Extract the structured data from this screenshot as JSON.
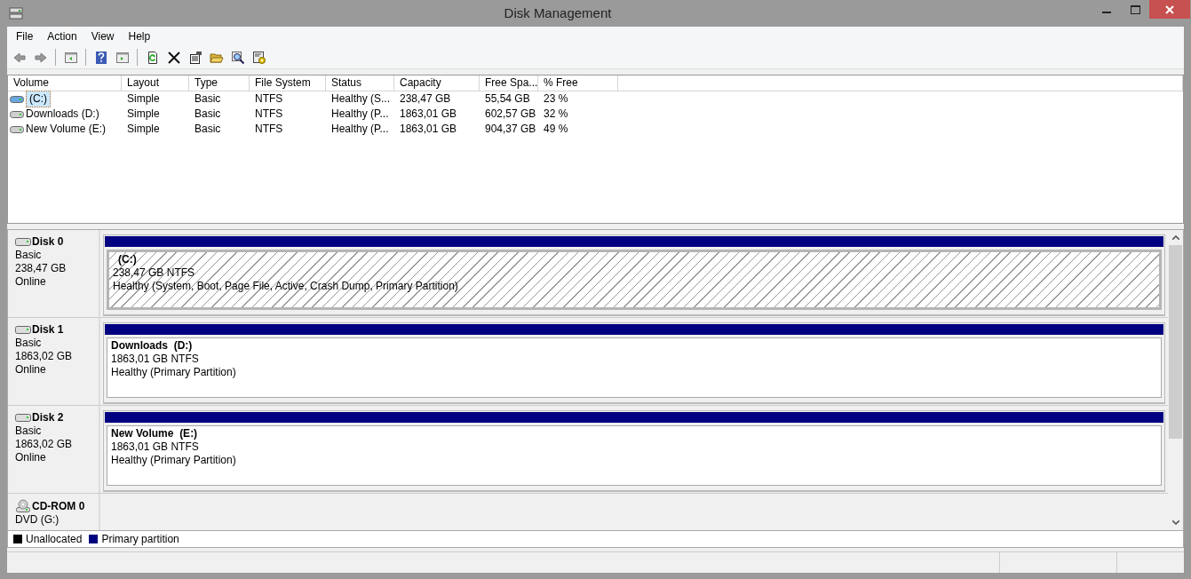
{
  "window": {
    "title": "Disk Management"
  },
  "menu": [
    "File",
    "Action",
    "View",
    "Help"
  ],
  "toolbar": [
    {
      "kind": "back"
    },
    {
      "kind": "forward"
    },
    {
      "kind": "sep"
    },
    {
      "kind": "pane"
    },
    {
      "kind": "sep"
    },
    {
      "kind": "help"
    },
    {
      "kind": "pane2"
    },
    {
      "kind": "sep"
    },
    {
      "kind": "refresh"
    },
    {
      "kind": "delete"
    },
    {
      "kind": "properties"
    },
    {
      "kind": "open"
    },
    {
      "kind": "explore"
    },
    {
      "kind": "settings"
    }
  ],
  "volume_table": {
    "columns": [
      "Volume",
      "Layout",
      "Type",
      "File System",
      "Status",
      "Capacity",
      "Free Spa...",
      "% Free"
    ],
    "rows": [
      {
        "selected": true,
        "cells": [
          "(C:)",
          "Simple",
          "Basic",
          "NTFS",
          "Healthy (S...",
          "238,47 GB",
          "55,54 GB",
          "23 %"
        ]
      },
      {
        "selected": false,
        "cells": [
          "Downloads (D:)",
          "Simple",
          "Basic",
          "NTFS",
          "Healthy (P...",
          "1863,01 GB",
          "602,57 GB",
          "32 %"
        ]
      },
      {
        "selected": false,
        "cells": [
          "New Volume (E:)",
          "Simple",
          "Basic",
          "NTFS",
          "Healthy (P...",
          "1863,01 GB",
          "904,37 GB",
          "49 %"
        ]
      }
    ]
  },
  "disks": [
    {
      "kind": "disk",
      "name": "Disk 0",
      "type": "Basic",
      "size": "238,47 GB",
      "status": "Online",
      "partitions": [
        {
          "label": "(C:)",
          "size": "238,47 GB NTFS",
          "status": "Healthy (System, Boot, Page File, Active, Crash Dump, Primary Partition)",
          "selected": true
        }
      ]
    },
    {
      "kind": "disk",
      "name": "Disk 1",
      "type": "Basic",
      "size": "1863,02 GB",
      "status": "Online",
      "partitions": [
        {
          "label": "Downloads  (D:)",
          "size": "1863,01 GB NTFS",
          "status": "Healthy (Primary Partition)",
          "selected": false
        }
      ]
    },
    {
      "kind": "disk",
      "name": "Disk 2",
      "type": "Basic",
      "size": "1863,02 GB",
      "status": "Online",
      "partitions": [
        {
          "label": "New Volume  (E:)",
          "size": "1863,01 GB NTFS",
          "status": "Healthy (Primary Partition)",
          "selected": false
        }
      ]
    },
    {
      "kind": "cdrom",
      "name": "CD-ROM 0",
      "type": "DVD (G:)"
    }
  ],
  "legend": [
    {
      "label": "Unallocated",
      "color": "#000000"
    },
    {
      "label": "Primary partition",
      "color": "#000080"
    }
  ]
}
